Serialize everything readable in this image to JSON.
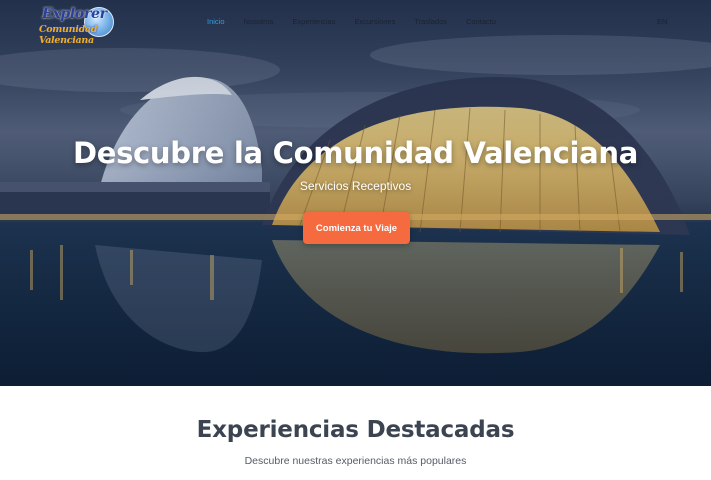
{
  "brand": {
    "logo_line1": "Explorer",
    "logo_line2": "Comunidad Valenciana"
  },
  "nav": {
    "items": [
      {
        "label": "Inicio",
        "active": true
      },
      {
        "label": "Nosotros",
        "active": false
      },
      {
        "label": "Experiencias",
        "active": false
      },
      {
        "label": "Excursiones",
        "active": false
      },
      {
        "label": "Traslados",
        "active": false
      },
      {
        "label": "Contacto",
        "active": false
      }
    ],
    "language": "EN"
  },
  "hero": {
    "title": "Descubre la Comunidad Valenciana",
    "subtitle": "Servicios Receptivos",
    "cta_label": "Comienza tu Viaje"
  },
  "featured": {
    "title": "Experiencias Destacadas",
    "subtitle": "Descubre nuestras experiencias más populares"
  },
  "colors": {
    "accent": "#f56a3f",
    "nav_active": "#2f9de0",
    "heading": "#3b4450"
  }
}
